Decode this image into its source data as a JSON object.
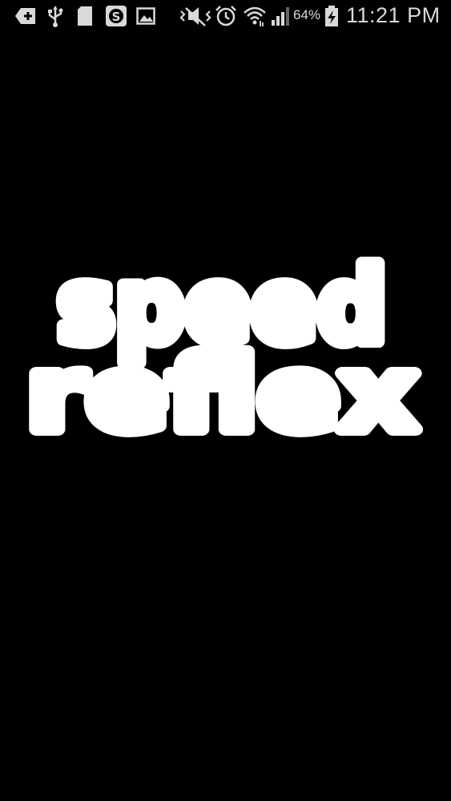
{
  "status_bar": {
    "icons": [
      "add-notification-icon",
      "usb-icon",
      "sd-card-icon",
      "skype-icon",
      "gallery-icon",
      "mute-icon",
      "alarm-icon",
      "wifi-icon",
      "signal-icon",
      "battery-charging-icon"
    ],
    "battery_percent": "64%",
    "time": "11:21 PM"
  },
  "splash": {
    "logo_line_1": "speed",
    "logo_line_2": "reflex",
    "background_color": "#000000",
    "logo_color": "#ffffff"
  }
}
